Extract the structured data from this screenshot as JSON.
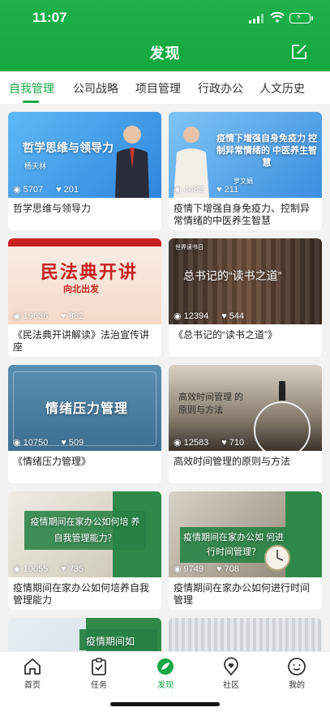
{
  "status": {
    "time": "11:07"
  },
  "header": {
    "title": "发现",
    "edit_icon": "edit-icon"
  },
  "tabs": [
    {
      "label": "自我管理",
      "active": true
    },
    {
      "label": "公司战略"
    },
    {
      "label": "项目管理"
    },
    {
      "label": "行政办公"
    },
    {
      "label": "人文历史"
    }
  ],
  "cards": [
    {
      "caption": "哲学思维与领导力",
      "views": "5707",
      "likes": "201",
      "thumb_title": "哲学思维与领导力",
      "thumb_sub": "杨天林"
    },
    {
      "caption": "疫情下增强自身免疫力、控制异常情绪的中医养生智慧",
      "views": "4482",
      "likes": "211",
      "thumb_title": "疫情下增强自身免疫力 控制异常情绪的 中医养生智慧",
      "thumb_sub": "罗文娟"
    },
    {
      "caption": "《民法典开讲解读》法治宣传讲座",
      "views": "19636",
      "likes": "882",
      "thumb_title": "民法典开讲",
      "thumb_sub": "向北出发"
    },
    {
      "caption": "《总书记的“读书之道”》",
      "views": "12394",
      "likes": "544",
      "thumb_title": "总书记的“读书之道”",
      "thumb_sub": "世界读书日"
    },
    {
      "caption": "《情绪压力管理》",
      "views": "10750",
      "likes": "509",
      "thumb_title": "情绪压力管理"
    },
    {
      "caption": "高效时间管理的原则与方法",
      "views": "12583",
      "likes": "710",
      "thumb_title": "高效时间管理 的原则与方法"
    },
    {
      "caption": "疫情期间在家办公如何培养自我管理能力",
      "views": "10055",
      "likes": "735",
      "thumb_title": "疫情期间在家办公如何培 养自我管理能力？"
    },
    {
      "caption": "疫情期间在家办公如何进行时间管理",
      "views": "9749",
      "likes": "708",
      "thumb_title": "疫情期间在家办公如 何进行时间管理？"
    },
    {
      "caption": "",
      "views": "",
      "likes": "",
      "thumb_title": "疫情期间如"
    },
    {
      "caption": "",
      "views": "",
      "likes": "",
      "thumb_title": ""
    }
  ],
  "bottom_nav": [
    {
      "label": "首页",
      "icon": "home-icon"
    },
    {
      "label": "任务",
      "icon": "task-icon"
    },
    {
      "label": "发现",
      "icon": "discover-icon",
      "active": true
    },
    {
      "label": "社区",
      "icon": "community-icon"
    },
    {
      "label": "我的",
      "icon": "profile-icon"
    }
  ],
  "colors": {
    "brand": "#18a846",
    "header": "#1aad48"
  }
}
